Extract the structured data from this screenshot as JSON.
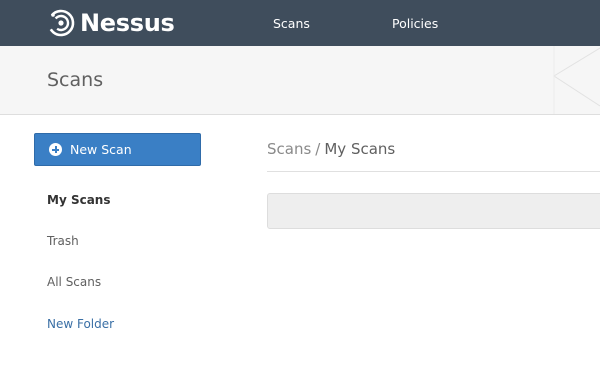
{
  "app": {
    "logo_text": "Nessus"
  },
  "topnav": {
    "items": [
      {
        "label": "Scans"
      },
      {
        "label": "Policies"
      }
    ]
  },
  "header": {
    "title": "Scans"
  },
  "sidebar": {
    "new_scan_label": "New Scan",
    "items": [
      {
        "label": "My Scans",
        "active": true
      },
      {
        "label": "Trash"
      },
      {
        "label": "All Scans"
      },
      {
        "label": "New Folder"
      }
    ]
  },
  "main": {
    "breadcrumb": {
      "root": "Scans",
      "separator": "/",
      "current": "My Scans"
    }
  },
  "colors": {
    "topbar": "#3f4d5c",
    "accent": "#3a7fc5",
    "link": "#3a6fa5"
  }
}
